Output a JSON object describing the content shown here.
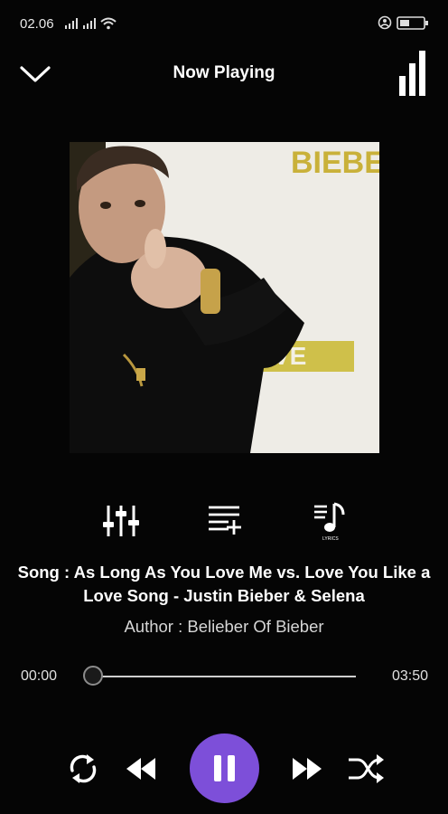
{
  "status": {
    "time": "02.06"
  },
  "header": {
    "title": "Now Playing"
  },
  "album": {
    "text_top": "BIEBE",
    "text_bottom": "VE"
  },
  "actions": {
    "lyrics_label": "LYRICS"
  },
  "song": {
    "title": "Song : As Long As You Love Me vs. Love You Like a Love Song - Justin Bieber & Selena",
    "author": "Author : Belieber Of Bieber"
  },
  "progress": {
    "current": "00:00",
    "total": "03:50",
    "fraction": 0.0
  },
  "colors": {
    "accent": "#7d4fd9",
    "background": "#050505"
  }
}
